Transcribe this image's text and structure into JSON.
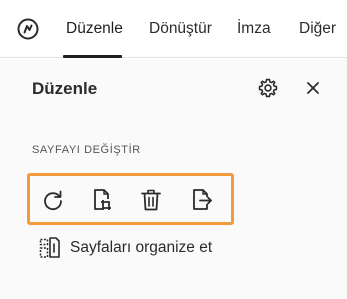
{
  "tabs": [
    {
      "label": "Düzenle",
      "active": true
    },
    {
      "label": "Dönüştür",
      "active": false
    },
    {
      "label": "İmza",
      "active": false
    },
    {
      "label": "Diğer",
      "active": false
    }
  ],
  "panel": {
    "title": "Düzenle",
    "section_label": "SAYFAYI DEĞİŞTİR",
    "tools": [
      {
        "icon": "rotate-icon"
      },
      {
        "icon": "crop-page-icon"
      },
      {
        "icon": "delete-icon"
      },
      {
        "icon": "extract-page-icon"
      }
    ],
    "organize_label": "Sayfaları organize et"
  },
  "colors": {
    "highlight": "#f39a3c",
    "active_underline": "#1f1f1f",
    "panel_bg": "#fafafa"
  }
}
